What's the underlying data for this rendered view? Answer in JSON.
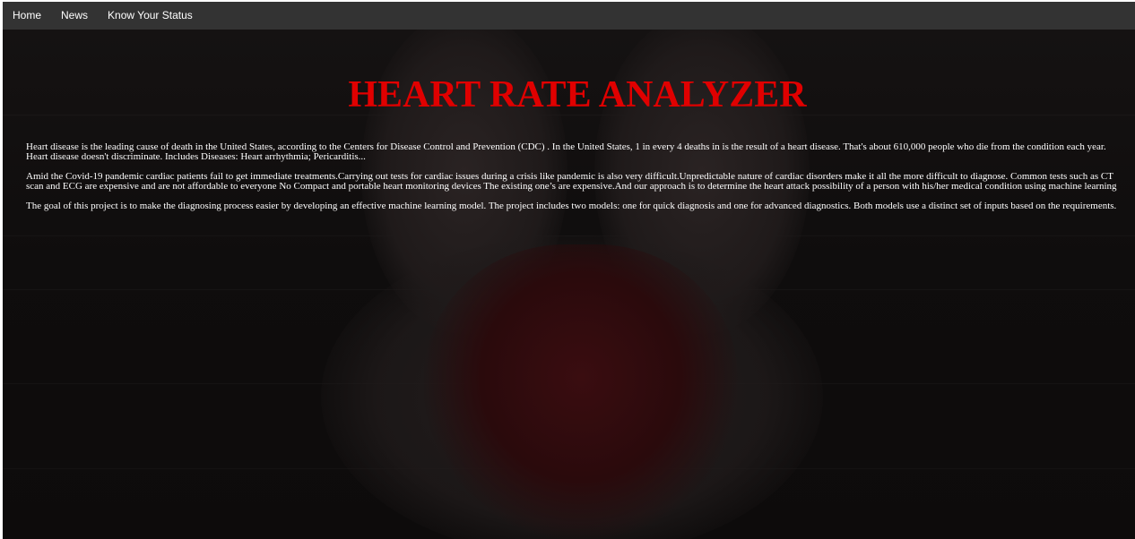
{
  "nav": {
    "items": [
      {
        "label": "Home"
      },
      {
        "label": "News"
      },
      {
        "label": "Know Your Status"
      }
    ]
  },
  "hero": {
    "title": "HEART RATE ANALYZER",
    "paragraphs": [
      "Heart disease is the leading cause of death in the United States, according to the Centers for Disease Control and Prevention (CDC) . In the United States, 1 in every 4 deaths in is the result of a heart disease. That's about 610,000 people who die from the condition each year. Heart disease doesn't discriminate. Includes Diseases: Heart arrhythmia; Pericarditis...",
      "Amid the Covid-19 pandemic cardiac patients fail to get immediate treatments.Carrying out tests for cardiac issues during a crisis like pandemic is also very difficult.Unpredictable nature of cardiac disorders make it all the more difficult to diagnose. Common tests such as CT scan and ECG are expensive and are not affordable to everyone No Compact and portable heart monitoring devices The existing one’s are expensive.And our approach is to determine the heart attack possibility of a person with his/her medical condition using machine learning",
      "The goal of this project is to make the diagnosing process easier by developing an effective machine learning model. The project includes two models: one for quick diagnosis and one for advanced diagnostics. Both models use a distinct set of inputs based on the requirements."
    ]
  },
  "colors": {
    "navbar_bg": "#333333",
    "title": "#e00000",
    "body_text": "#ffffff",
    "background": "#0c0a0a"
  }
}
